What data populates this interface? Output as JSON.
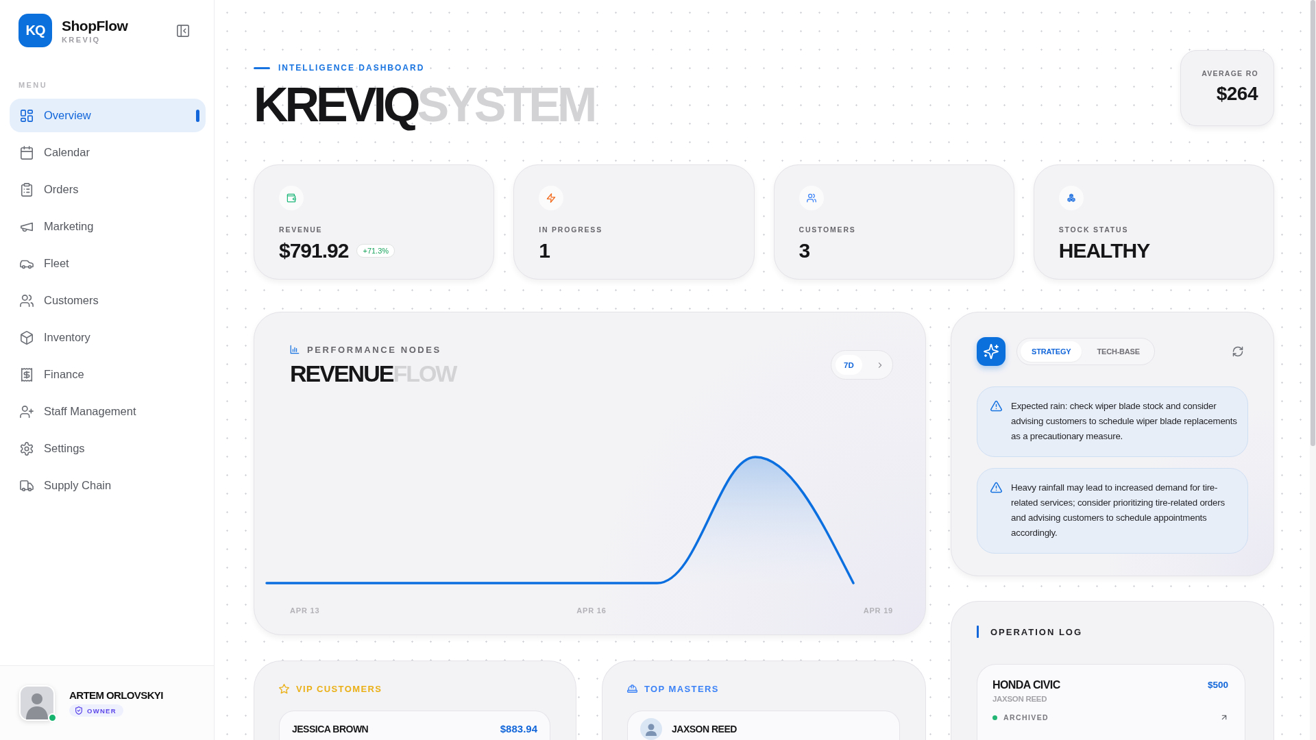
{
  "sidebar": {
    "brand": {
      "logo": "KQ",
      "name": "ShopFlow",
      "subtitle": "KREVIQ"
    },
    "menu_label": "MENU",
    "items": [
      {
        "label": "Overview",
        "selected": true
      },
      {
        "label": "Calendar",
        "selected": false
      },
      {
        "label": "Orders",
        "selected": false
      },
      {
        "label": "Marketing",
        "selected": false
      },
      {
        "label": "Fleet",
        "selected": false
      },
      {
        "label": "Customers",
        "selected": false
      },
      {
        "label": "Inventory",
        "selected": false
      },
      {
        "label": "Finance",
        "selected": false
      },
      {
        "label": "Staff Management",
        "selected": false
      },
      {
        "label": "Settings",
        "selected": false
      },
      {
        "label": "Supply Chain",
        "selected": false
      }
    ],
    "user": {
      "name": "ARTEM ORLOVSKYI",
      "role": "OWNER",
      "online": true
    }
  },
  "header": {
    "eyebrow": "INTELLIGENCE DASHBOARD",
    "title_primary": "KREVIQ",
    "title_secondary": "SYSTEM",
    "average": {
      "label": "AVERAGE RO",
      "value": "$264"
    }
  },
  "stats": [
    {
      "label": "REVENUE",
      "value": "$791.92",
      "change": "+71.3%"
    },
    {
      "label": "IN PROGRESS",
      "value": "1"
    },
    {
      "label": "CUSTOMERS",
      "value": "3"
    },
    {
      "label": "STOCK STATUS",
      "value": "HEALTHY"
    }
  ],
  "performance": {
    "eyebrow": "PERFORMANCE NODES",
    "title_primary": "REVENUE",
    "title_secondary": "FLOW",
    "ranges": [
      {
        "label": "7D",
        "selected": true
      }
    ],
    "x_labels": [
      "APR 13",
      "APR 16",
      "APR 19"
    ]
  },
  "vip_customers": {
    "title": "VIP CUSTOMERS",
    "rows": [
      {
        "name": "JESSICA BROWN",
        "amount": "$883.94"
      }
    ]
  },
  "top_masters": {
    "title": "TOP MASTERS",
    "rows": [
      {
        "name": "JAXSON REED"
      }
    ]
  },
  "insights": {
    "tabs": [
      {
        "label": "STRATEGY",
        "selected": true
      },
      {
        "label": "TECH-BASE",
        "selected": false
      }
    ],
    "alerts": [
      {
        "text": "Expected rain: check wiper blade stock and consider advising customers to schedule wiper blade replacements as a precautionary measure."
      },
      {
        "text": "Heavy rainfall may lead to increased demand for tire-related services; consider prioritizing tire-related orders and advising customers to schedule appointments accordingly."
      }
    ]
  },
  "operation_log": {
    "title": "OPERATION LOG",
    "entries": [
      {
        "vehicle": "HONDA CIVIC",
        "amount": "$500",
        "technician": "JAXSON REED",
        "status": "ARCHIVED",
        "color": "#22b573"
      }
    ]
  }
}
